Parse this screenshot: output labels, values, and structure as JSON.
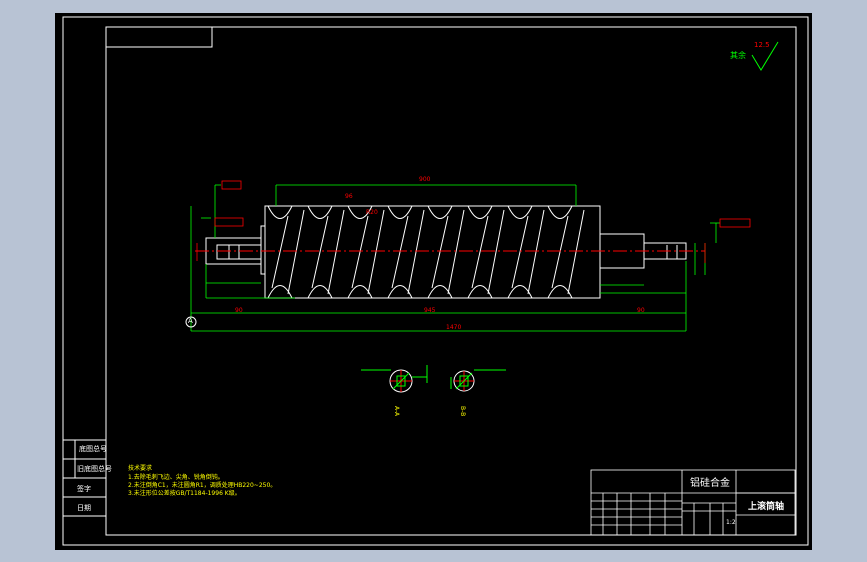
{
  "surface_finish": {
    "prefix": "其余",
    "value": "12.5"
  },
  "material": "铝硅合金",
  "part_name": "上滚筒轴",
  "scale": "1:2",
  "tech_requirements": {
    "title": "技术要求",
    "lines": [
      "1.去除毛刺飞边、尖角、锐角倒钝。",
      "2.未注倒角C1，未注圆角R1，调质处理HB220~250。",
      "3.未注形位公差按GB/T1184-1996 K级。"
    ]
  },
  "left_column_labels": [
    "底图总号",
    "旧底图总号",
    "签字",
    "日期"
  ],
  "dimensions": {
    "overall_length": "1470",
    "roller_length": "900",
    "middle_span": "945",
    "left_shaft": "90",
    "right_shaft": "90",
    "pitch": "96",
    "groove_r": "R20"
  },
  "sections": {
    "left": "A-A",
    "right": "B-B"
  },
  "datum": "A",
  "colors": {
    "frame": "#ffffff",
    "outline": "#ffffff",
    "dimension": "#00ff00",
    "annotation": "#ff0000",
    "text": "#ffff00",
    "background": "#000000"
  }
}
